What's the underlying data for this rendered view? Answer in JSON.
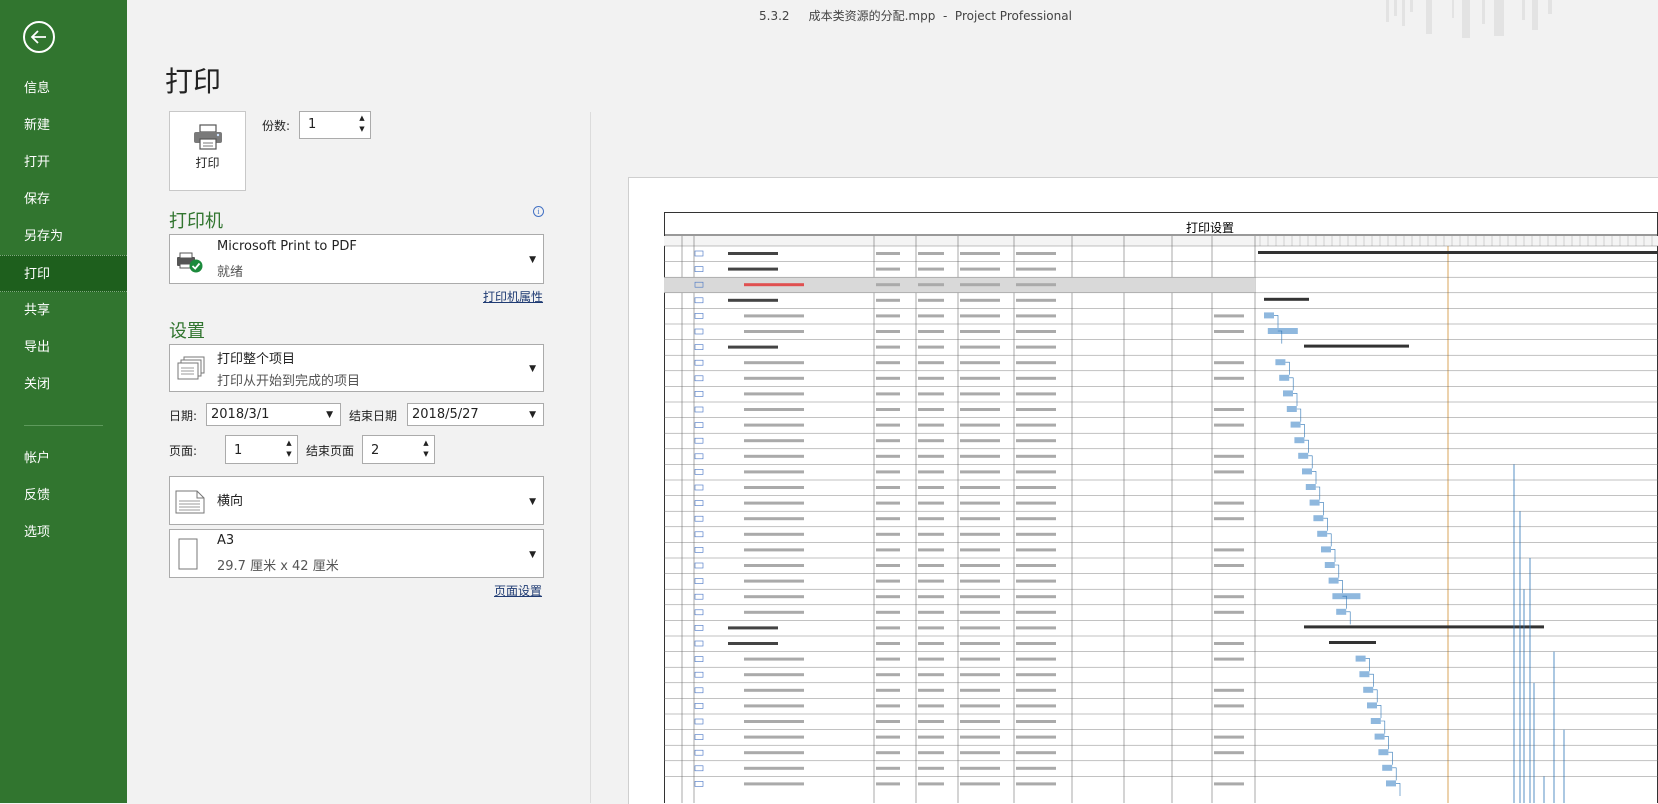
{
  "window": {
    "title": "5.3.2     成本类资源的分配.mpp  -  Project Professional"
  },
  "sidebar": {
    "back_label": "返回",
    "items": [
      {
        "label": "信息",
        "key": "info"
      },
      {
        "label": "新建",
        "key": "new"
      },
      {
        "label": "打开",
        "key": "open"
      },
      {
        "label": "保存",
        "key": "save"
      },
      {
        "label": "另存为",
        "key": "saveas"
      },
      {
        "label": "打印",
        "key": "print",
        "active": true
      },
      {
        "label": "共享",
        "key": "share"
      },
      {
        "label": "导出",
        "key": "export"
      },
      {
        "label": "关闭",
        "key": "close"
      }
    ],
    "bottom_items": [
      {
        "label": "帐户",
        "key": "account"
      },
      {
        "label": "反馈",
        "key": "feedback"
      },
      {
        "label": "选项",
        "key": "options"
      }
    ]
  },
  "print": {
    "page_title": "打印",
    "print_button": "打印",
    "copies_label": "份数:",
    "copies_value": "1"
  },
  "printer": {
    "heading": "打印机",
    "name": "Microsoft Print to PDF",
    "status": "就绪",
    "properties_link": "打印机属性"
  },
  "settings": {
    "heading": "设置",
    "scope_main": "打印整个项目",
    "scope_sub": "打印从开始到完成的项目",
    "date_label": "日期:",
    "date_value": "2018/3/1",
    "end_date_label": "结束日期",
    "end_date_value": "2018/5/27",
    "page_label": "页面:",
    "page_value": "1",
    "end_page_label": "结束页面",
    "end_page_value": "2",
    "orientation": "横向",
    "paper_size": "A3",
    "paper_dims": "29.7 厘米 x 42 厘米",
    "page_setup_link": "页面设置"
  },
  "preview": {
    "title": "打印设置"
  },
  "colors": {
    "sidebar": "#31752f",
    "accent": "#31752f",
    "link": "#1f3b73",
    "gantt_bar": "#8fb8de",
    "link_line": "#2e75b6",
    "status_line": "#d9a55b"
  }
}
